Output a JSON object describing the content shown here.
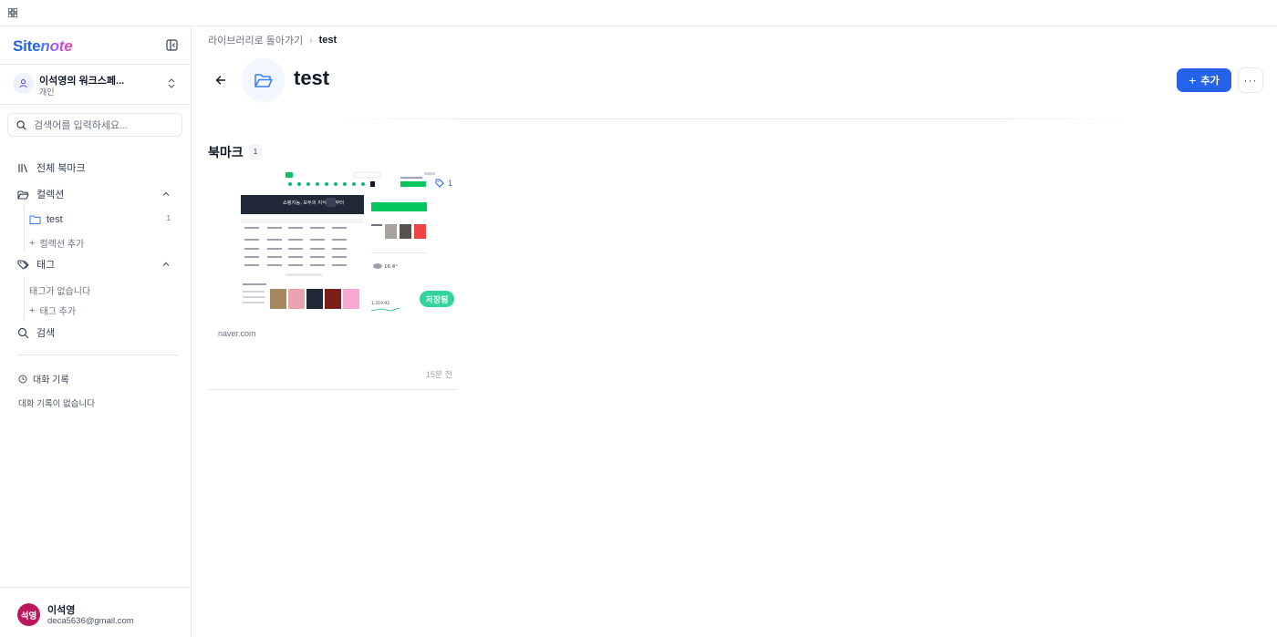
{
  "app": {
    "logo_site": "Site",
    "logo_note": "note"
  },
  "workspace": {
    "name": "이석영의 워크스페...",
    "type": "개인"
  },
  "search": {
    "placeholder": "검색어를 입력하세요..."
  },
  "sidebar": {
    "all_bookmarks": "전체 북마크",
    "collections": "컬렉션",
    "collection_items": [
      {
        "label": "test",
        "count": "1"
      }
    ],
    "add_collection": "컬렉션 추가",
    "tags": "태그",
    "no_tags": "태그가 없습니다",
    "add_tag": "태그 추가",
    "search": "검색",
    "history_title": "대화 기록",
    "history_empty": "대화 기록이 없습니다"
  },
  "user": {
    "initials": "석영",
    "name": "이석영",
    "email": "deca5636@gmail.com"
  },
  "breadcrumb": {
    "back_label": "라이브러리로 돌아가기",
    "current": "test"
  },
  "header": {
    "title": "test",
    "add_label": "추가",
    "more_label": "···"
  },
  "section": {
    "title": "북마크",
    "count": "1"
  },
  "bookmarks": [
    {
      "domain": "naver.com",
      "time": "15분 전",
      "saved_label": "저장됨",
      "tag_count": "1",
      "thumb_banner": "쇼핑지능, 모두의 지식으로부터",
      "thumb_weather": "16.4°",
      "thumb_stock": "1,319.93"
    }
  ],
  "colors": {
    "accent": "#2563eb",
    "saved": "#34d399",
    "avatar": "#be185d"
  }
}
